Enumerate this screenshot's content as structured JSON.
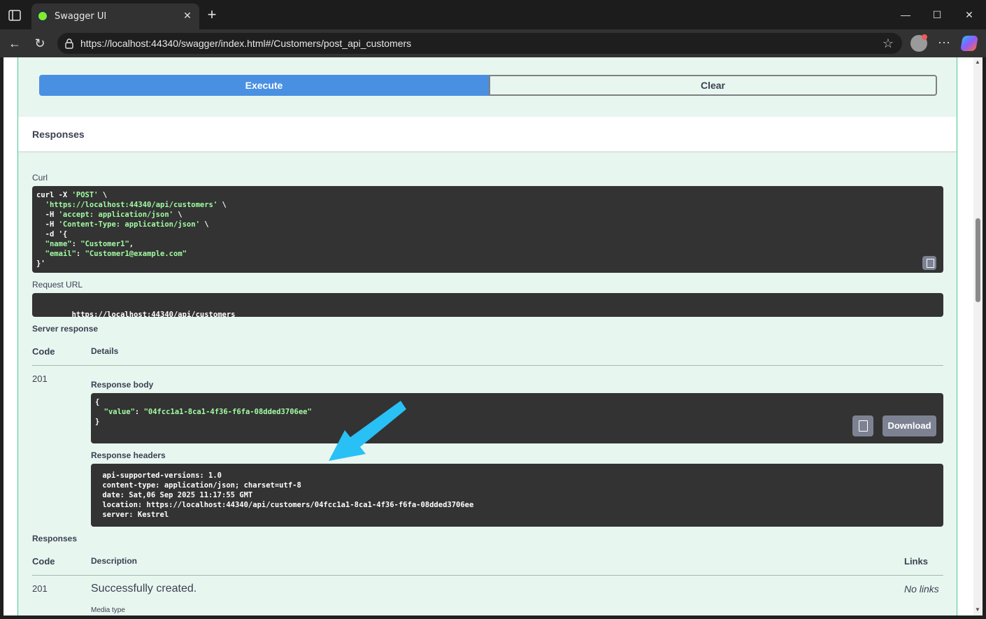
{
  "browser": {
    "tab_title": "Swagger UI",
    "url": "https://localhost:44340/swagger/index.html#/Customers/post_api_customers"
  },
  "actions": {
    "execute_label": "Execute",
    "clear_label": "Clear"
  },
  "responses_section": {
    "title": "Responses",
    "curl_label": "Curl",
    "curl_lines": [
      "curl -X 'POST' \\",
      "  'https://localhost:44340/api/customers' \\",
      "  -H 'accept: application/json' \\",
      "  -H 'Content-Type: application/json' \\",
      "  -d '{",
      "  \"name\": \"Customer1\",",
      "  \"email\": \"Customer1@example.com\"",
      "}'"
    ],
    "request_url_label": "Request URL",
    "request_url": "https://localhost:44340/api/customers",
    "server_response_label": "Server response",
    "code_header": "Code",
    "details_header": "Details",
    "status_code": "201",
    "response_body_label": "Response body",
    "response_body_lines": [
      "{",
      "  \"value\": \"04fcc1a1-8ca1-4f36-f6fa-08dded3706ee\"",
      "}"
    ],
    "download_label": "Download",
    "response_headers_label": "Response headers",
    "response_headers_lines": [
      " api-supported-versions: 1.0",
      " content-type: application/json; charset=utf-8",
      " date: Sat,06 Sep 2025 11:17:55 GMT",
      " location: https://localhost:44340/api/customers/04fcc1a1-8ca1-4f36-f6fa-08dded3706ee",
      " server: Kestrel"
    ]
  },
  "documented_responses": {
    "title": "Responses",
    "code_header": "Code",
    "description_header": "Description",
    "links_header": "Links",
    "rows": [
      {
        "code": "201",
        "description": "Successfully created.",
        "links": "No links",
        "media_type_label": "Media type"
      }
    ]
  },
  "colors": {
    "execute": "#4990e2",
    "opblock_bg": "#e8f6f0",
    "opblock_border": "#49cc90",
    "code_bg": "#333333",
    "string_green": "#a2fca2",
    "annotation_arrow": "#29c0f5"
  }
}
